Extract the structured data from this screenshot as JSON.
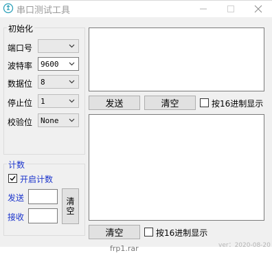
{
  "window": {
    "title": "串口测试工具",
    "version": "ver：2020-08-20"
  },
  "background_taskbar_text": "frp1.rar",
  "init": {
    "group_title": "初始化",
    "port_label": "端口号",
    "port_value": "",
    "baud_label": "波特率",
    "baud_value": "9600",
    "databits_label": "数据位",
    "databits_value": "8",
    "stopbits_label": "停止位",
    "stopbits_value": "1",
    "parity_label": "校验位",
    "parity_value": "None"
  },
  "count": {
    "group_title": "计数",
    "enable_label": "开启计数",
    "enable_checked": true,
    "send_label": "发送",
    "send_value": "",
    "recv_label": "接收",
    "recv_value": "",
    "clear_label": "清空"
  },
  "send_panel": {
    "text": "",
    "send_button": "发送",
    "clear_button": "清空",
    "hex_label": "按16进制显示",
    "hex_checked": false
  },
  "receive_panel": {
    "text": "",
    "clear_button": "清空",
    "hex_label": "按16进制显示",
    "hex_checked": false
  }
}
